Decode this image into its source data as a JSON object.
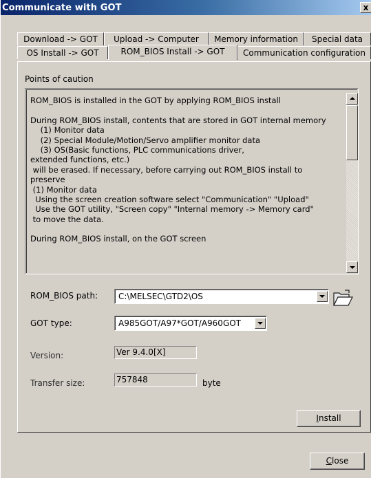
{
  "window": {
    "title": "Communicate with GOT",
    "close_label": "x"
  },
  "tabs": {
    "row1": [
      "Download -> GOT",
      "Upload -> Computer",
      "Memory information",
      "Special data"
    ],
    "row2": [
      "OS Install -> GOT",
      "ROM_BIOS Install -> GOT",
      "Communication configuration"
    ],
    "active": "ROM_BIOS Install -> GOT"
  },
  "caution": {
    "heading": "Points of caution",
    "lines": [
      "ROM_BIOS is installed in the GOT by applying ROM_BIOS install",
      "",
      "During ROM_BIOS install, contents that are stored in GOT internal memory",
      "    (1) Monitor data",
      "    (2) Special Module/Motion/Servo amplifier monitor data",
      "    (3) OS(Basic functions, PLC communications driver,",
      "extended functions, etc.)",
      " will be erased. If necessary, before carrying out ROM_BIOS install to",
      "preserve",
      " (1) Monitor data",
      "  Using the screen creation software select \"Communication\" \"Upload\"",
      "  Use the GOT utility, \"Screen copy\" \"Internal memory -> Memory card\"",
      " to move the data.",
      "",
      "During ROM_BIOS install, on the GOT screen"
    ]
  },
  "form": {
    "rom_bios_path_label": "ROM_BIOS path:",
    "rom_bios_path_value": "C:\\MELSEC\\GTD2\\OS",
    "got_type_label": "GOT type:",
    "got_type_value": "A985GOT/A97*GOT/A960GOT",
    "version_label": "Version:",
    "version_value": "Ver 9.4.0[X]",
    "transfer_size_label": "Transfer size:",
    "transfer_size_value": "757848",
    "transfer_size_unit": "byte"
  },
  "buttons": {
    "install_prefix": "",
    "install_ul": "I",
    "install_rest": "nstall",
    "close_ul": "C",
    "close_rest": "lose"
  },
  "icons": {
    "browse": "folder-open-icon",
    "scroll_up": "arrow-up-icon",
    "scroll_down": "arrow-down-icon",
    "dropdown": "chevron-down-icon"
  },
  "colors": {
    "title_start": "#0a246a",
    "title_end": "#a6caf0",
    "face": "#d4d0c8"
  }
}
